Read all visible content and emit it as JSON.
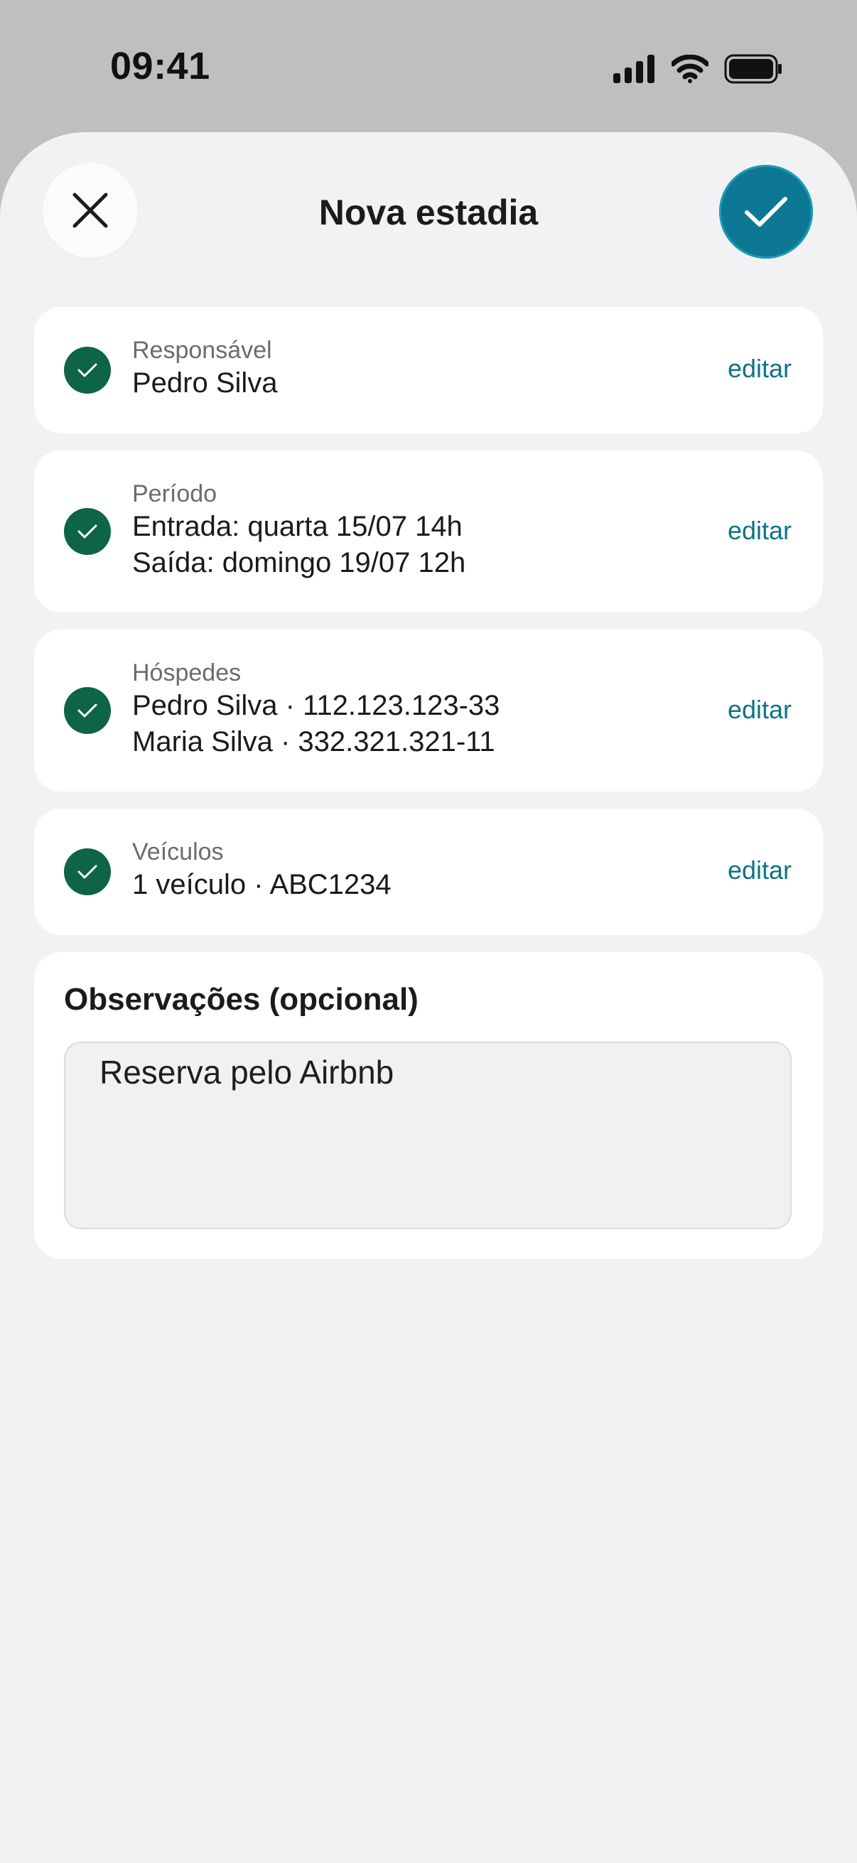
{
  "status_bar": {
    "time": "09:41",
    "icons": [
      "cellular-signal-icon",
      "wifi-icon",
      "battery-icon"
    ]
  },
  "header": {
    "title": "Nova estadia",
    "close_icon": "close-icon",
    "confirm_icon": "checkmark-icon"
  },
  "sections": [
    {
      "label": "Responsável",
      "lines": [
        "Pedro Silva"
      ],
      "action": "editar"
    },
    {
      "label": "Período",
      "lines": [
        "Entrada: quarta 15/07 14h",
        "Saída: domingo 19/07 12h"
      ],
      "action": "editar"
    },
    {
      "label": "Hóspedes",
      "lines": [
        "Pedro Silva · 112.123.123-33",
        "Maria Silva · 332.321.321-11"
      ],
      "action": "editar"
    },
    {
      "label": "Veículos",
      "lines": [
        "1 veículo · ABC1234"
      ],
      "action": "editar"
    }
  ],
  "notes": {
    "title": "Observações (opcional)",
    "value": "Reserva pelo Airbnb"
  },
  "colors": {
    "accent": "#0d7894",
    "success": "#0d6446",
    "link": "#0e7389"
  }
}
